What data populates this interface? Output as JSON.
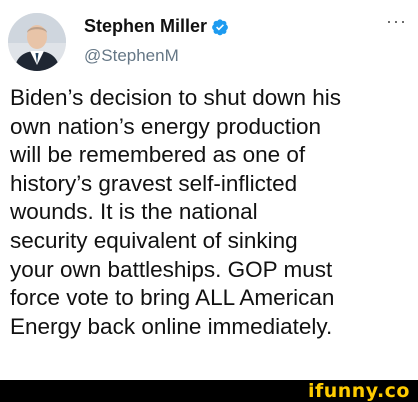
{
  "tweet": {
    "author_name": "Stephen Miller",
    "handle": "@StephenM",
    "more_glyph": "···",
    "lines": [
      "Biden’s decision to shut down his",
      "own nation’s energy production",
      "will be remembered as one of",
      "history’s gravest self-inflicted",
      "wounds. It is the national",
      "security equivalent of sinking",
      "your own battleships. GOP must",
      "force vote to bring ALL American",
      "Energy back online immediately."
    ]
  },
  "watermark": {
    "text": "ifunny.co"
  },
  "colors": {
    "verified_blue": "#1d9bf0",
    "watermark_yellow": "#ffcc00"
  }
}
